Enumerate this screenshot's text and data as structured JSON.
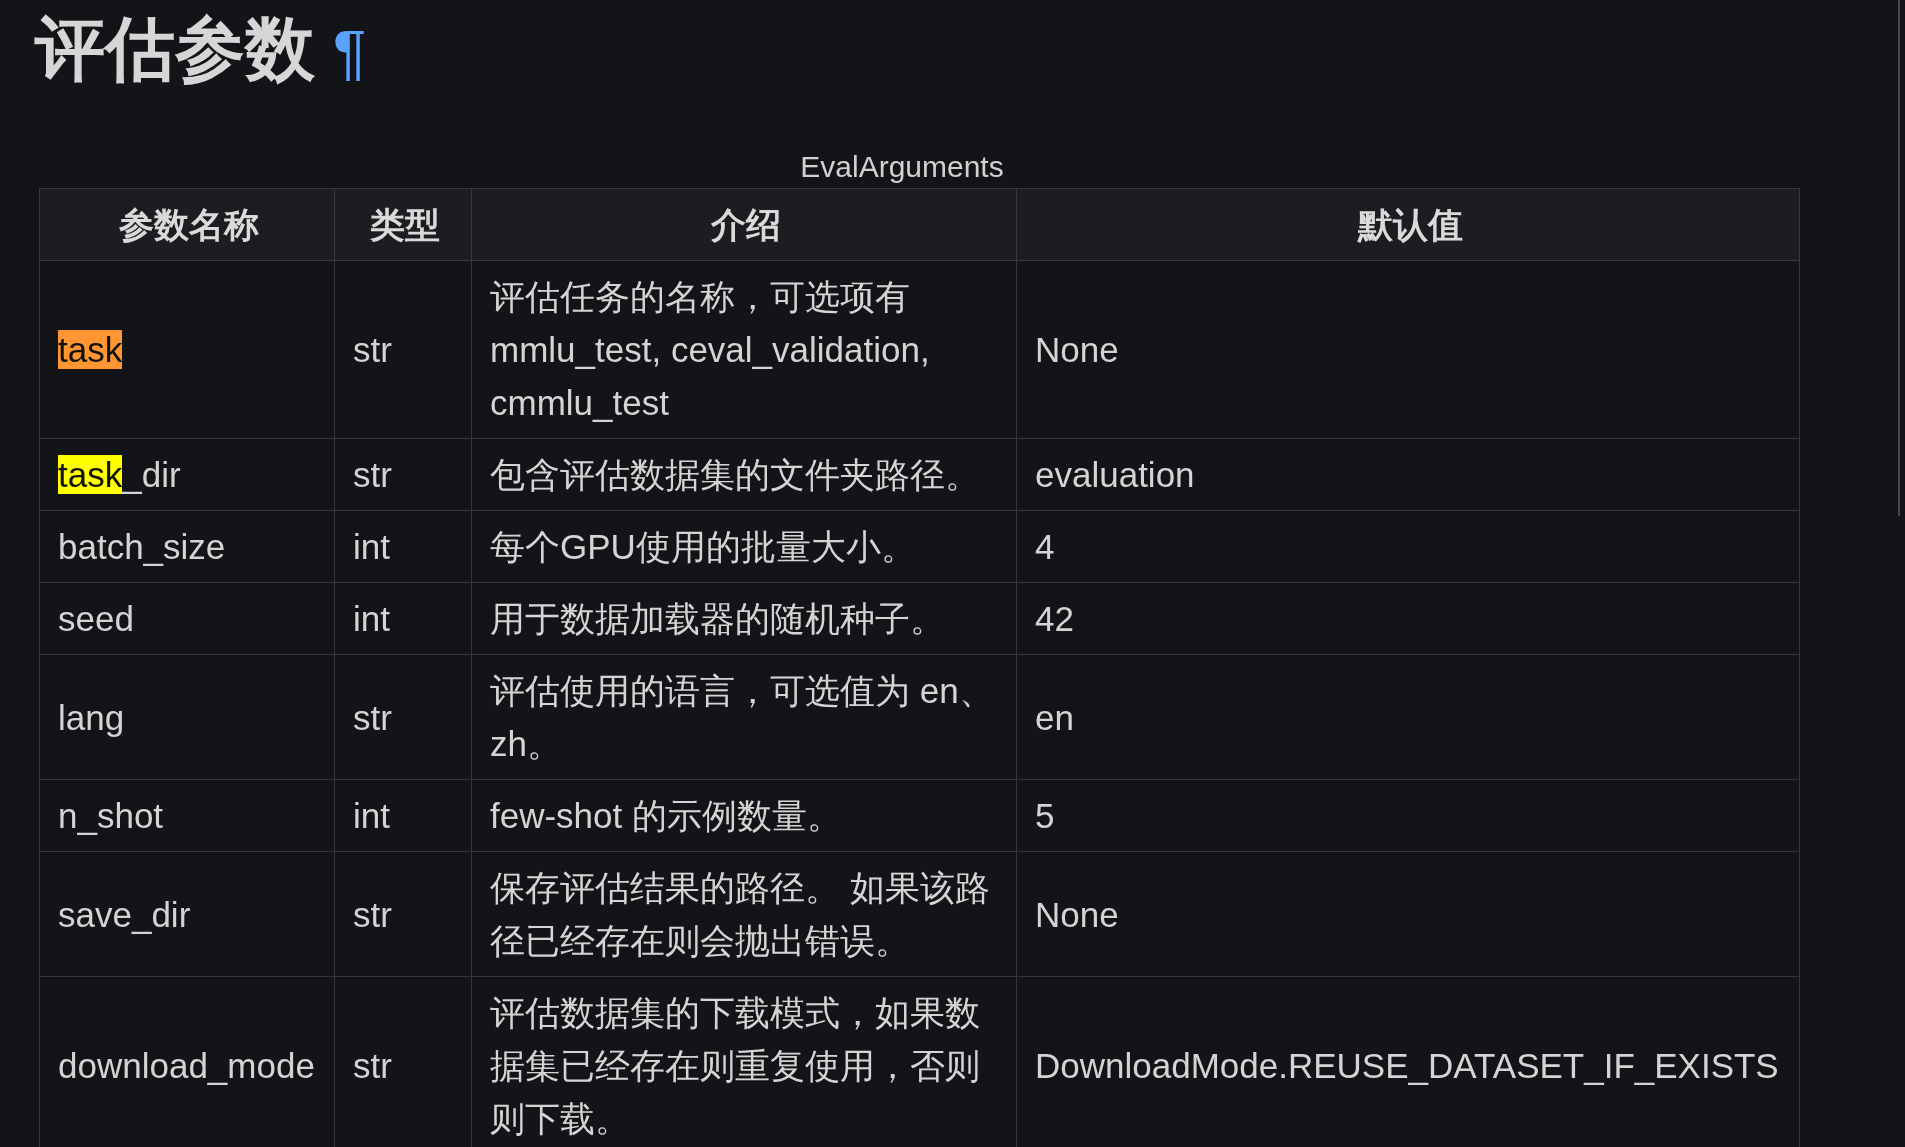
{
  "heading": {
    "title": "评估参数",
    "anchor": "¶"
  },
  "table": {
    "caption": "EvalArguments",
    "columns": [
      "参数名称",
      "类型",
      "介绍",
      "默认值"
    ],
    "rows": [
      {
        "name": [
          {
            "text": "task",
            "highlighted": true,
            "current": true
          }
        ],
        "type": "str",
        "description": "评估任务的名称，可选项有 mmlu_test, ceval_validation, cmmlu_test",
        "default": "None"
      },
      {
        "name": [
          {
            "text": "task",
            "highlighted": true,
            "current": false
          },
          {
            "text": "_dir",
            "highlighted": false,
            "current": false
          }
        ],
        "type": "str",
        "description": "包含评估数据集的文件夹路径。",
        "default": "evaluation"
      },
      {
        "name": [
          {
            "text": "batch_size",
            "highlighted": false,
            "current": false
          }
        ],
        "type": "int",
        "description": "每个GPU使用的批量大小。",
        "default": "4"
      },
      {
        "name": [
          {
            "text": "seed",
            "highlighted": false,
            "current": false
          }
        ],
        "type": "int",
        "description": "用于数据加载器的随机种子。",
        "default": "42"
      },
      {
        "name": [
          {
            "text": "lang",
            "highlighted": false,
            "current": false
          }
        ],
        "type": "str",
        "description": "评估使用的语言，可选值为 en、zh。",
        "default": "en"
      },
      {
        "name": [
          {
            "text": "n_shot",
            "highlighted": false,
            "current": false
          }
        ],
        "type": "int",
        "description": "few-shot 的示例数量。",
        "default": "5"
      },
      {
        "name": [
          {
            "text": "save_dir",
            "highlighted": false,
            "current": false
          }
        ],
        "type": "str",
        "description": "保存评估结果的路径。 如果该路径已经存在则会抛出错误。",
        "default": "None"
      },
      {
        "name": [
          {
            "text": "download_mode",
            "highlighted": false,
            "current": false
          }
        ],
        "type": "str",
        "description": "评估数据集的下载模式，如果数据集已经存在则重复使用，否则则下载。",
        "default": "DownloadMode.REUSE_DATASET_IF_EXISTS"
      }
    ]
  }
}
